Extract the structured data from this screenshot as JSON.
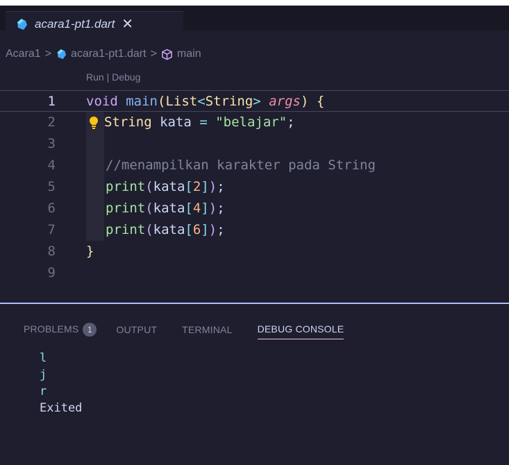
{
  "tab": {
    "title": "acara1-pt1.dart",
    "close": "✕"
  },
  "breadcrumb": {
    "folder": "Acara1",
    "sep1": ">",
    "file": "acara1-pt1.dart",
    "sep2": ">",
    "symbol": "main"
  },
  "codelens": {
    "run": "Run",
    "sep": " | ",
    "debug": "Debug"
  },
  "editor": {
    "lines": [
      {
        "n": "1",
        "kw": "void",
        "fn": "main",
        "open": "(",
        "ty1": "List",
        "lt": "<",
        "ty2": "String",
        "gt": ">",
        "sp": " ",
        "arg": "args",
        "close": ")",
        "brace": "{"
      },
      {
        "n": "2",
        "ty": "String",
        "var": "kata",
        "eq": "=",
        "str": "\"belajar\"",
        "semi": ";"
      },
      {
        "n": "3"
      },
      {
        "n": "4",
        "cmt": "//menampilkan karakter pada String"
      },
      {
        "n": "5",
        "fn": "print",
        "var": "kata",
        "num": "2",
        "tail": ";"
      },
      {
        "n": "6",
        "fn": "print",
        "var": "kata",
        "num": "4",
        "tail": ";"
      },
      {
        "n": "7",
        "fn": "print",
        "var": "kata",
        "num": "6",
        "tail": ";"
      },
      {
        "n": "8",
        "brace": "}"
      },
      {
        "n": "9"
      }
    ]
  },
  "panel": {
    "tabs": [
      "PROBLEMS",
      "OUTPUT",
      "TERMINAL",
      "DEBUG CONSOLE"
    ],
    "problems_count": "1",
    "active_tab": "DEBUG CONSOLE",
    "console": [
      "l",
      "j",
      "r",
      "Exited"
    ]
  },
  "colors": {
    "editor_bg": "#1e1e2e",
    "keyword": "#cba6f7",
    "function": "#89b4fa",
    "type": "#f9e2af",
    "string": "#a6e3a1",
    "panel_border": "#b4befe"
  },
  "icons": [
    "dart-file-icon",
    "cube-icon",
    "lightbulb-icon",
    "close-icon"
  ]
}
